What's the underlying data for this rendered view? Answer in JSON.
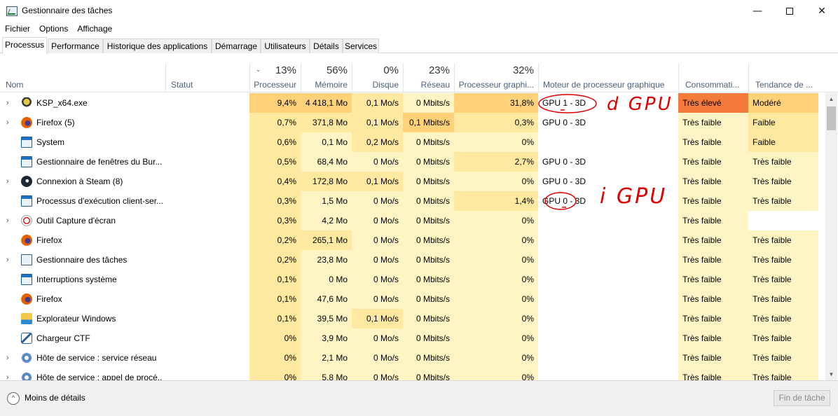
{
  "window": {
    "title": "Gestionnaire des tâches",
    "minimize_glyph": "—",
    "close_glyph": "✕"
  },
  "menu": [
    "Fichier",
    "Options",
    "Affichage"
  ],
  "tabs": [
    "Processus",
    "Performance",
    "Historique des applications",
    "Démarrage",
    "Utilisateurs",
    "Détails",
    "Services"
  ],
  "active_tab": "Processus",
  "columns": {
    "name": {
      "label": "Nom"
    },
    "status": {
      "label": "Statut"
    },
    "cpu": {
      "pct": "13%",
      "label": "Processeur",
      "sort_glyph": "⌄"
    },
    "memory": {
      "pct": "56%",
      "label": "Mémoire"
    },
    "disk": {
      "pct": "0%",
      "label": "Disque"
    },
    "network": {
      "pct": "23%",
      "label": "Réseau"
    },
    "gpu": {
      "pct": "32%",
      "label": "Processeur graphi..."
    },
    "gpu_engine": {
      "label": "Moteur de processeur graphique"
    },
    "power": {
      "label": "Consommati..."
    },
    "power_trend": {
      "label": "Tendance de ..."
    }
  },
  "processes": [
    {
      "name": "KSP_x64.exe",
      "icon": "ksp-icon",
      "expandable": true,
      "status": "",
      "cpu": "9,4%",
      "memory": "4 418,1 Mo",
      "disk": "0,1 Mo/s",
      "network": "0 Mbits/s",
      "gpu": "31,8%",
      "gpu_engine": "GPU 1 - 3D",
      "power": "Très élevé",
      "power_trend": "Modéré"
    },
    {
      "name": "Firefox (5)",
      "icon": "firefox-icon",
      "expandable": true,
      "status": "",
      "cpu": "0,7%",
      "memory": "371,8 Mo",
      "disk": "0,1 Mo/s",
      "network": "0,1 Mbits/s",
      "gpu": "0,3%",
      "gpu_engine": "GPU 0 - 3D",
      "power": "Très faible",
      "power_trend": "Faible"
    },
    {
      "name": "System",
      "icon": "system-icon",
      "expandable": false,
      "status": "",
      "cpu": "0,6%",
      "memory": "0,1 Mo",
      "disk": "0,2 Mo/s",
      "network": "0 Mbits/s",
      "gpu": "0%",
      "gpu_engine": "",
      "power": "Très faible",
      "power_trend": "Faible"
    },
    {
      "name": "Gestionnaire de fenêtres du Bur...",
      "icon": "window-manager-icon",
      "expandable": false,
      "status": "",
      "cpu": "0,5%",
      "memory": "68,4 Mo",
      "disk": "0 Mo/s",
      "network": "0 Mbits/s",
      "gpu": "2,7%",
      "gpu_engine": "GPU 0 - 3D",
      "power": "Très faible",
      "power_trend": "Très faible"
    },
    {
      "name": "Connexion à Steam (8)",
      "icon": "steam-icon",
      "expandable": true,
      "status": "",
      "cpu": "0,4%",
      "memory": "172,8 Mo",
      "disk": "0,1 Mo/s",
      "network": "0 Mbits/s",
      "gpu": "0%",
      "gpu_engine": "GPU 0 - 3D",
      "power": "Très faible",
      "power_trend": "Très faible"
    },
    {
      "name": "Processus d'exécution client-ser...",
      "icon": "csrss-icon",
      "expandable": false,
      "status": "",
      "cpu": "0,3%",
      "memory": "1,5 Mo",
      "disk": "0 Mo/s",
      "network": "0 Mbits/s",
      "gpu": "1,4%",
      "gpu_engine": "GPU 0 - 3D",
      "power": "Très faible",
      "power_trend": "Très faible"
    },
    {
      "name": "Outil Capture d'écran",
      "icon": "snipping-tool-icon",
      "expandable": true,
      "status": "",
      "cpu": "0,3%",
      "memory": "4,2 Mo",
      "disk": "0 Mo/s",
      "network": "0 Mbits/s",
      "gpu": "0%",
      "gpu_engine": "",
      "power": "Très faible",
      "power_trend": ""
    },
    {
      "name": "Firefox",
      "icon": "firefox-icon",
      "expandable": false,
      "status": "",
      "cpu": "0,2%",
      "memory": "265,1 Mo",
      "disk": "0 Mo/s",
      "network": "0 Mbits/s",
      "gpu": "0%",
      "gpu_engine": "",
      "power": "Très faible",
      "power_trend": "Très faible"
    },
    {
      "name": "Gestionnaire des tâches",
      "icon": "task-manager-icon",
      "expandable": true,
      "status": "",
      "cpu": "0,2%",
      "memory": "23,8 Mo",
      "disk": "0 Mo/s",
      "network": "0 Mbits/s",
      "gpu": "0%",
      "gpu_engine": "",
      "power": "Très faible",
      "power_trend": "Très faible"
    },
    {
      "name": "Interruptions système",
      "icon": "system-icon",
      "expandable": false,
      "status": "",
      "cpu": "0,1%",
      "memory": "0 Mo",
      "disk": "0 Mo/s",
      "network": "0 Mbits/s",
      "gpu": "0%",
      "gpu_engine": "",
      "power": "Très faible",
      "power_trend": "Très faible"
    },
    {
      "name": "Firefox",
      "icon": "firefox-icon",
      "expandable": false,
      "status": "",
      "cpu": "0,1%",
      "memory": "47,6 Mo",
      "disk": "0 Mo/s",
      "network": "0 Mbits/s",
      "gpu": "0%",
      "gpu_engine": "",
      "power": "Très faible",
      "power_trend": "Très faible"
    },
    {
      "name": "Explorateur Windows",
      "icon": "explorer-icon",
      "expandable": false,
      "status": "",
      "cpu": "0,1%",
      "memory": "39,5 Mo",
      "disk": "0,1 Mo/s",
      "network": "0 Mbits/s",
      "gpu": "0%",
      "gpu_engine": "",
      "power": "Très faible",
      "power_trend": "Très faible"
    },
    {
      "name": "Chargeur CTF",
      "icon": "ctf-loader-icon",
      "expandable": false,
      "status": "",
      "cpu": "0%",
      "memory": "3,9 Mo",
      "disk": "0 Mo/s",
      "network": "0 Mbits/s",
      "gpu": "0%",
      "gpu_engine": "",
      "power": "Très faible",
      "power_trend": "Très faible"
    },
    {
      "name": "Hôte de service : service réseau",
      "icon": "service-host-icon",
      "expandable": true,
      "status": "",
      "cpu": "0%",
      "memory": "2,1 Mo",
      "disk": "0 Mo/s",
      "network": "0 Mbits/s",
      "gpu": "0%",
      "gpu_engine": "",
      "power": "Très faible",
      "power_trend": "Très faible"
    },
    {
      "name": "Hôte de service : appel de procé...",
      "icon": "service-host-icon",
      "expandable": true,
      "status": "",
      "cpu": "0%",
      "memory": "5,8 Mo",
      "disk": "0 Mo/s",
      "network": "0 Mbits/s",
      "gpu": "0%",
      "gpu_engine": "",
      "power": "Très faible",
      "power_trend": "Très faible"
    }
  ],
  "footer": {
    "less_details": "Moins de détails",
    "less_details_glyph": "^",
    "end_task": "Fin de tâche"
  },
  "annotations": {
    "dgpu": "d GPU",
    "igpu": "i GPU"
  },
  "colors": {
    "heat_low": "#fff4c4",
    "heat_mid": "#ffe8a0",
    "heat_high": "#ffd27a",
    "power_very_high": "#f47a3c",
    "annotation_red": "#e00000"
  }
}
